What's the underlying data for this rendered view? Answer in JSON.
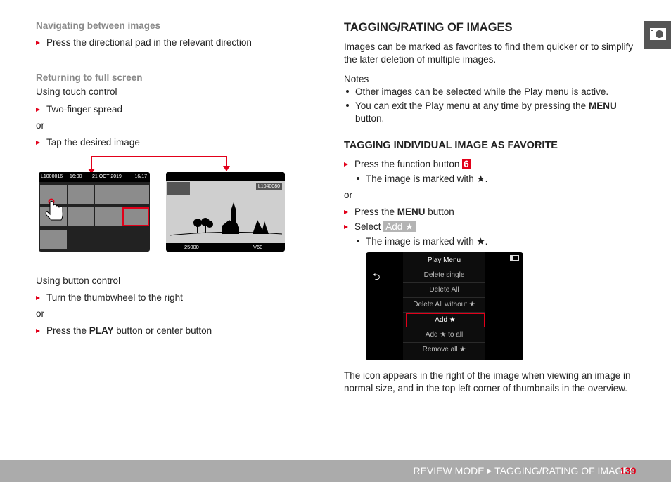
{
  "left": {
    "nav_heading": "Navigating between images",
    "nav_step": "Press the directional pad in the relevant direction",
    "return_heading": "Returning to full screen",
    "touch_label": "Using touch control",
    "touch_step1": "Two-finger spread",
    "or1": "or",
    "touch_step2": "Tap the desired image",
    "thumb_screen": {
      "file": "L1000016",
      "time": "16:00",
      "date": "21 OCT 2019",
      "count": "16/17"
    },
    "full_screen": {
      "file": "L1040080",
      "iso": "25000",
      "shutter": "V60"
    },
    "button_label": "Using button control",
    "button_step1": "Turn the thumbwheel to the right",
    "or2": "or",
    "button_step2_pre": "Press the ",
    "button_step2_key": "PLAY",
    "button_step2_post": " button or center button"
  },
  "right": {
    "title": "TAGGING/RATING OF IMAGES",
    "intro": "Images can be marked as favorites to find them quicker or to simplify the later deletion of multiple images.",
    "notes_heading": "Notes",
    "note1": "Other images can be selected while the Play menu is active.",
    "note2_pre": "You can exit the Play menu at any time by pressing the ",
    "note2_key": "MENU",
    "note2_post": "button.",
    "sub_heading": "TAGGING INDIVIDUAL IMAGE AS FAVORITE",
    "step1_pre": "Press the function button ",
    "step1_badge": "6",
    "result1": "The image is marked with ★.",
    "or": "or",
    "step2_pre": "Press the ",
    "step2_key": "MENU",
    "step2_post": " button",
    "step3_pre": "Select ",
    "step3_badge": "Add ★",
    "result2": "The image is marked with ★.",
    "menu": {
      "title": "Play Menu",
      "items": [
        "Delete single",
        "Delete All",
        "Delete All without ★",
        "Add ★",
        "Add ★ to all",
        "Remove all ★"
      ],
      "selected": "Add ★"
    },
    "outro": "The icon appears in the right of the image when viewing an image in normal size, and in the top left corner of thumbnails in the overview."
  },
  "side_tab": {
    "icon": "camera-play-icon"
  },
  "footer": {
    "section": "REVIEW MODE",
    "topic": "TAGGING/RATING OF IMAGES",
    "page": "139"
  },
  "colors": {
    "accent": "#e2001a",
    "footer_bg": "#ababab"
  }
}
